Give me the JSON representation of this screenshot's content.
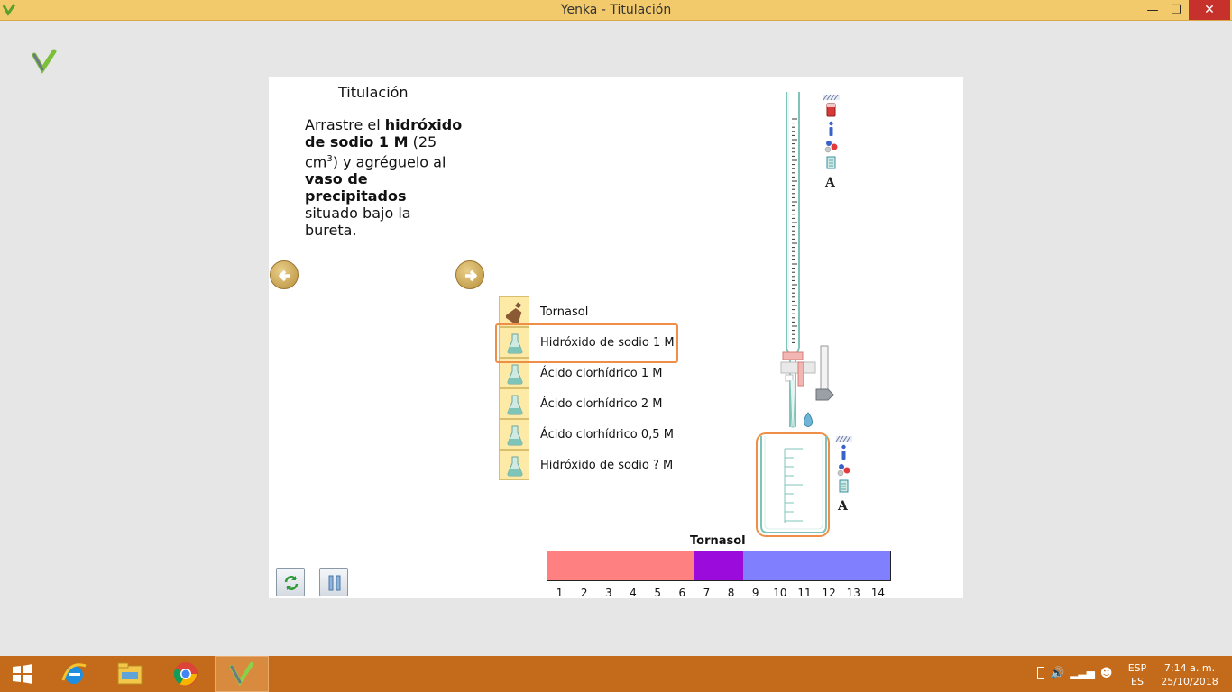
{
  "window": {
    "title": "Yenka - Titulación",
    "minimize_icon": "minimize-icon",
    "maximize_icon": "restore-icon",
    "close_icon": "close-icon"
  },
  "panel": {
    "title": "Titulación",
    "instructions": {
      "t1": "Arrastre el ",
      "b1": "hidróxido de sodio 1 M",
      "t2": " (25 cm",
      "sup": "3",
      "t3": ") y agréguelo al ",
      "b2": "vaso de precipitados",
      "t4": " situado bajo la bureta."
    }
  },
  "navigation": {
    "prev_icon": "arrow-left-icon",
    "next_icon": "arrow-right-icon"
  },
  "chemicals": [
    {
      "label": "Tornasol",
      "icon": "dropper-bottle-icon"
    },
    {
      "label": "Hidróxido de sodio 1 M",
      "icon": "flask-icon",
      "selected": true
    },
    {
      "label": "Ácido clorhídrico 1 M",
      "icon": "flask-icon"
    },
    {
      "label": "Ácido clorhídrico 2 M",
      "icon": "flask-icon"
    },
    {
      "label": "Ácido clorhídrico 0,5 M",
      "icon": "flask-icon"
    },
    {
      "label": "Hidróxido  de sodio ? M",
      "icon": "flask-icon"
    }
  ],
  "burette_tools": [
    "fill-icon",
    "info-icon",
    "molecule-icon",
    "beaker-icon",
    "text-icon"
  ],
  "beaker_tools": [
    "info-icon",
    "molecule-icon",
    "beaker-icon",
    "text-icon"
  ],
  "indicator_scale": {
    "title": "Tornasol",
    "ticks": [
      "1",
      "2",
      "3",
      "4",
      "5",
      "6",
      "7",
      "8",
      "9",
      "10",
      "11",
      "12",
      "13",
      "14"
    ],
    "segments": [
      {
        "color": "#ff8080",
        "from_ph": 0.5,
        "to_ph": 6.5
      },
      {
        "color": "#9b0bdb",
        "from_ph": 6.5,
        "to_ph": 8.5
      },
      {
        "color": "#8080ff",
        "from_ph": 8.5,
        "to_ph": 14.5
      }
    ]
  },
  "controls": {
    "reset_icon": "refresh-icon",
    "pause_icon": "pause-icon"
  },
  "taskbar": {
    "apps": [
      "windows-start-icon",
      "internet-explorer-icon",
      "file-explorer-icon",
      "chrome-icon",
      "yenka-icon"
    ],
    "lang_top": "ESP",
    "lang_bottom": "ES",
    "time": "7:14 a. m.",
    "date": "25/10/2018"
  },
  "colors": {
    "titlebar": "#f3ca6b",
    "taskbar": "#c46b1b",
    "highlight": "#ef8f47",
    "liquid_teal": "#7fc4b8"
  }
}
